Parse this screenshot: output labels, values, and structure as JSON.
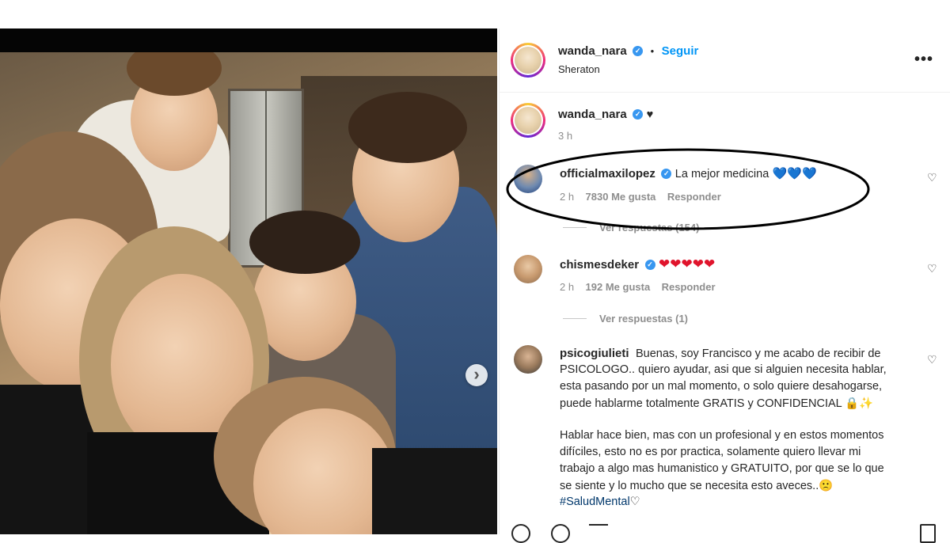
{
  "post": {
    "author": "wanda_nara",
    "follow_label": "Seguir",
    "separator": "•",
    "location": "Sheraton",
    "more_label": "•••"
  },
  "caption": {
    "author": "wanda_nara",
    "text": "♥",
    "time": "3 h"
  },
  "comments": [
    {
      "author": "officialmaxilopez",
      "text": "La mejor medicina",
      "emoji": "💙💙💙",
      "time": "2 h",
      "likes": "7830 Me gusta",
      "reply_label": "Responder",
      "view_replies": "Ver respuestas (154)"
    },
    {
      "author": "chismesdeker",
      "emoji": "❤❤❤❤❤",
      "time": "2 h",
      "likes": "192 Me gusta",
      "reply_label": "Responder",
      "view_replies": "Ver respuestas (1)"
    },
    {
      "author": "psicogiulieti",
      "lines": [
        "Buenas, soy Francisco y me acabo de recibir de",
        "PSICOLOGO.. quiero ayudar, asi que si alguien necesita hablar,",
        "esta pasando por un mal momento, o solo quiere desahogarse,",
        "puede hablarme totalmente GRATIS y CONFIDENCIAL 🔒✨",
        "",
        "Hablar hace bien, mas con un profesional y en estos momentos",
        "difíciles, esto no es por practica, solamente quiero llevar mi",
        "trabajo a algo mas humanistico y GRATUITO, por que se lo que",
        "se siente y lo mucho que se necesita esto aveces..🙁"
      ],
      "hashtag": "#SaludMental",
      "hashtag_suffix": "♡"
    }
  ],
  "colors": {
    "link_blue": "#0095f6",
    "verified_blue": "#3897f0",
    "muted": "#8e8e8e",
    "ellipse": "#000000"
  },
  "icons": [
    "verified-badge-icon",
    "heart-icon",
    "chevron-right-icon",
    "more-options-icon",
    "comment-icon",
    "share-icon",
    "save-icon"
  ]
}
